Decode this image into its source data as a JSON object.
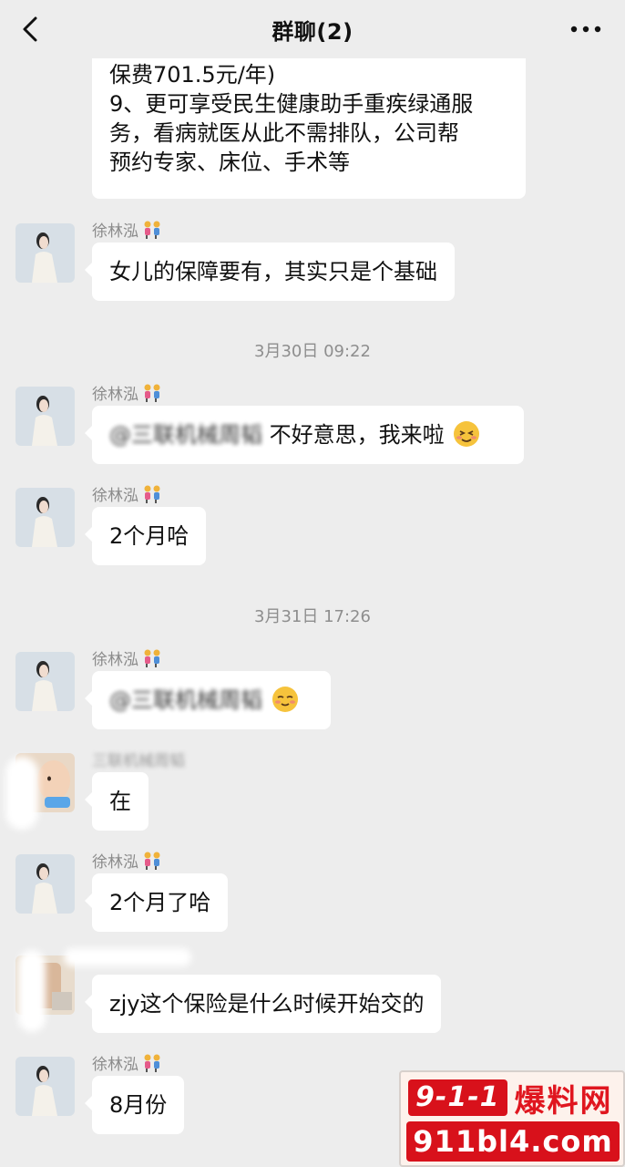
{
  "header": {
    "title": "群聊(2)",
    "back_icon": "chevron-left-icon",
    "more_icon": "more-dots-icon"
  },
  "messages": [
    {
      "type": "text",
      "lines": [
        "保费701.5元/年)",
        "9、更可享受民生健康助手重疾绿通服",
        "务，看病就医从此不需排队，公司帮",
        "预约专家、床位、手术等"
      ]
    },
    {
      "type": "text",
      "sender": "徐林泓",
      "text": "女儿的保障要有，其实只是个基础"
    },
    {
      "type": "timestamp",
      "text": "3月30日 09:22"
    },
    {
      "type": "text",
      "sender": "徐林泓",
      "mention": "@三联机械周韬",
      "text": " 不好意思，我来啦",
      "emoji": "embarrassed-smile-emoji"
    },
    {
      "type": "text",
      "sender": "徐林泓",
      "text": "2个月哈"
    },
    {
      "type": "timestamp",
      "text": "3月31日 17:26"
    },
    {
      "type": "text",
      "sender": "徐林泓",
      "mention": "@三联机械周韬",
      "emoji": "shy-smile-emoji"
    },
    {
      "type": "text",
      "sender": "三联机械周韬",
      "text": "在"
    },
    {
      "type": "text",
      "sender": "徐林泓",
      "text": "2个月了哈"
    },
    {
      "type": "text",
      "sender": "",
      "text": "zjy这个保险是什么时候开始交的"
    },
    {
      "type": "text",
      "sender": "徐林泓",
      "text": "8月份"
    }
  ],
  "sender_badge_icon": "two-girls-emoji",
  "watermark": {
    "top_number": "9-1-1",
    "top_text": "爆料网",
    "bottom_text": "911bl4.com"
  },
  "colors": {
    "background": "#ededed",
    "bubble": "#ffffff",
    "watermark_red": "#d8111b"
  }
}
